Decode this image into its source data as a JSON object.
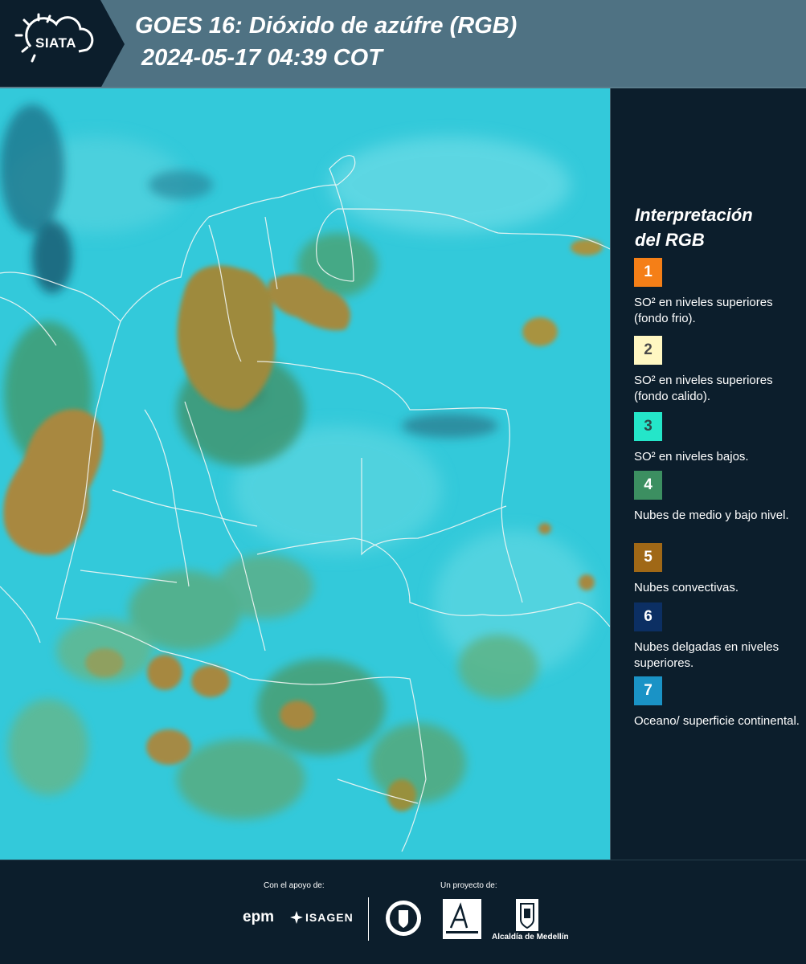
{
  "header": {
    "logo_text": "SIATA",
    "title_line1": "GOES 16: Dióxido de azúfre (RGB)",
    "title_line2": "2024-05-17 04:39 COT"
  },
  "map": {
    "background_color": "#33c9da",
    "icon": "satellite-rgb-composite-map"
  },
  "legend": {
    "title_line1": "Interpretación",
    "title_line2": "del RGB",
    "items": [
      {
        "number": "1",
        "text": "SO² en niveles superiores (fondo frio).",
        "color": "#f57f17",
        "number_color": "#ffffff"
      },
      {
        "number": "2",
        "text": "SO² en niveles superiores (fondo calido).",
        "color": "#fff7c2",
        "number_color": "#4a4a4a"
      },
      {
        "number": "3",
        "text": "SO² en niveles bajos.",
        "color": "#24e6c9",
        "number_color": "#2d4a4a"
      },
      {
        "number": "4",
        "text": "Nubes de medio y bajo nivel.",
        "color": "#3c8f61",
        "number_color": "#ffffff"
      },
      {
        "number": "5",
        "text": "Nubes convectivas.",
        "color": "#a06816",
        "number_color": "#ffffff"
      },
      {
        "number": "6",
        "text": "Nubes delgadas en niveles superiores.",
        "color": "#0c2f63",
        "number_color": "#ffffff"
      },
      {
        "number": "7",
        "text": "Oceano/ superficie continental.",
        "color": "#1a93c6",
        "number_color": "#ffffff"
      }
    ]
  },
  "footer": {
    "support_label": "Con el apoyo de:",
    "project_label": "Un proyecto de:",
    "epm": "epm",
    "isagen": "ISAGEN",
    "alcaldia": "Alcaldía de Medellín"
  }
}
